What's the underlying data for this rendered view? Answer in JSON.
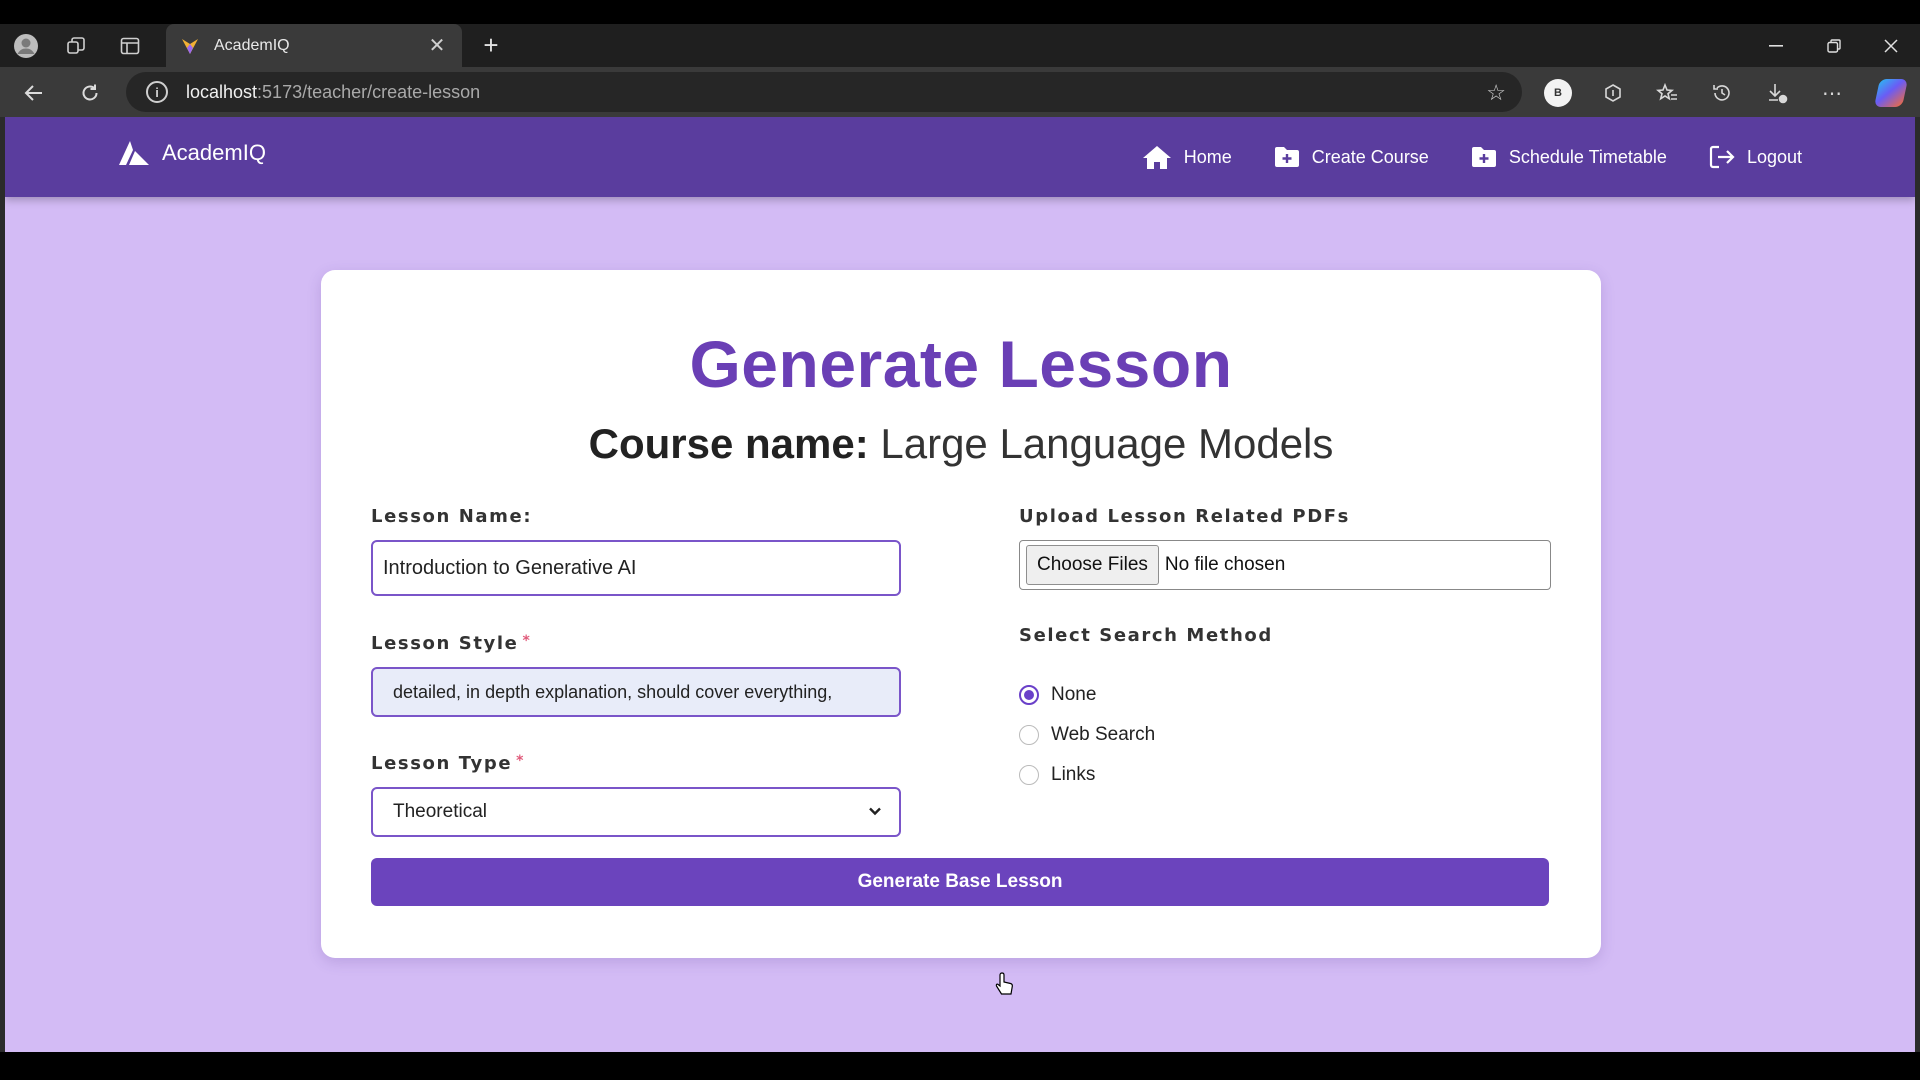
{
  "browser": {
    "tab_title": "AcademIQ",
    "url_host": "localhost",
    "url_path": ":5173/teacher/create-lesson",
    "profile_initial": "B"
  },
  "navbar": {
    "brand": "AcademIQ",
    "links": [
      {
        "label": "Home",
        "icon": "home-icon"
      },
      {
        "label": "Create Course",
        "icon": "folder-plus-icon"
      },
      {
        "label": "Schedule Timetable",
        "icon": "folder-plus-icon"
      },
      {
        "label": "Logout",
        "icon": "logout-icon"
      }
    ]
  },
  "form": {
    "title": "Generate Lesson",
    "course_label": "Course name:",
    "course_name": "Large Language Models",
    "lesson_name_label": "Lesson Name:",
    "lesson_name_value": "Introduction to Generative AI",
    "lesson_style_label": "Lesson Style",
    "lesson_style_value": "detailed, in depth explanation, should cover everything,",
    "lesson_type_label": "Lesson Type",
    "lesson_type_value": "Theoretical",
    "required_mark": "*",
    "upload_label": "Upload Lesson Related PDFs",
    "choose_files": "Choose Files",
    "no_file": "No file chosen",
    "search_method_label": "Select Search Method",
    "search_options": [
      {
        "label": "None",
        "selected": true
      },
      {
        "label": "Web Search",
        "selected": false
      },
      {
        "label": "Links",
        "selected": false
      }
    ],
    "submit_label": "Generate Base Lesson"
  },
  "colors": {
    "navbar": "#5a3d9e",
    "page_bg": "#d3bbf5",
    "accent": "#6a3fb5",
    "button": "#6b44bd"
  }
}
